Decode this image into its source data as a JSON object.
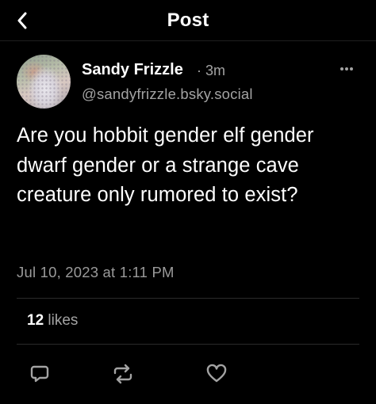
{
  "header": {
    "title": "Post",
    "back_icon": "chevron-left-icon"
  },
  "post": {
    "author_name": "Sandy Frizzle",
    "time_ago": "· 3m",
    "handle": "@sandyfrizzle.bsky.social",
    "text": "Are you hobbit gender elf gender dwarf gender or a strange cave creature only rumored to exist?",
    "timestamp": "Jul 10, 2023 at 1:11 PM",
    "more_icon": "ellipsis-icon"
  },
  "stats": {
    "likes_count": "12",
    "likes_label": "likes"
  },
  "actions": [
    {
      "name": "reply",
      "icon": "comment-icon"
    },
    {
      "name": "repost",
      "icon": "repost-icon"
    },
    {
      "name": "like",
      "icon": "heart-icon"
    }
  ],
  "colors": {
    "background": "#000000",
    "text": "#ffffff",
    "muted": "#a3a3a3",
    "divider": "#2a2a2a"
  }
}
